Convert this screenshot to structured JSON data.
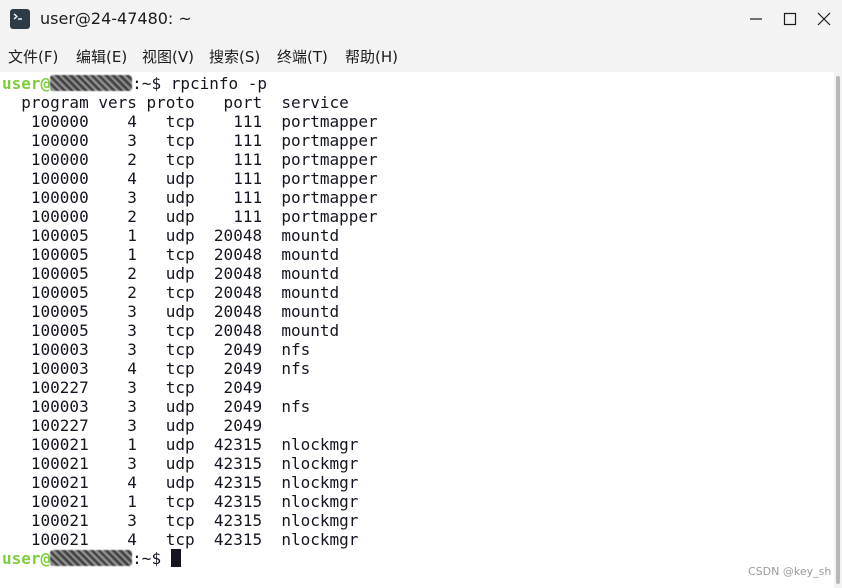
{
  "window": {
    "title": "user@24-47480: ~",
    "icon": "terminal-icon"
  },
  "menu": [
    "文件(F)",
    "编辑(E)",
    "视图(V)",
    "搜索(S)",
    "终端(T)",
    "帮助(H)"
  ],
  "terminal": {
    "prompt_user": "user@",
    "prompt_suffix": ":~$ ",
    "command": "rpcinfo -p",
    "header": "  program vers proto   port  service",
    "rows": [
      "   100000    4   tcp    111  portmapper",
      "   100000    3   tcp    111  portmapper",
      "   100000    2   tcp    111  portmapper",
      "   100000    4   udp    111  portmapper",
      "   100000    3   udp    111  portmapper",
      "   100000    2   udp    111  portmapper",
      "   100005    1   udp  20048  mountd",
      "   100005    1   tcp  20048  mountd",
      "   100005    2   udp  20048  mountd",
      "   100005    2   tcp  20048  mountd",
      "   100005    3   udp  20048  mountd",
      "   100005    3   tcp  20048  mountd",
      "   100003    3   tcp   2049  nfs",
      "   100003    4   tcp   2049  nfs",
      "   100227    3   tcp   2049",
      "   100003    3   udp   2049  nfs",
      "   100227    3   udp   2049",
      "   100021    1   udp  42315  nlockmgr",
      "   100021    3   udp  42315  nlockmgr",
      "   100021    4   udp  42315  nlockmgr",
      "   100021    1   tcp  42315  nlockmgr",
      "   100021    3   tcp  42315  nlockmgr",
      "   100021    4   tcp  42315  nlockmgr"
    ]
  },
  "watermark": "CSDN @key_sh",
  "colors": {
    "prompt_user": "#7fce3e",
    "terminal_bg": "#ffffff",
    "terminal_fg": "#171421",
    "chrome_bg": "#f3f3f3"
  }
}
